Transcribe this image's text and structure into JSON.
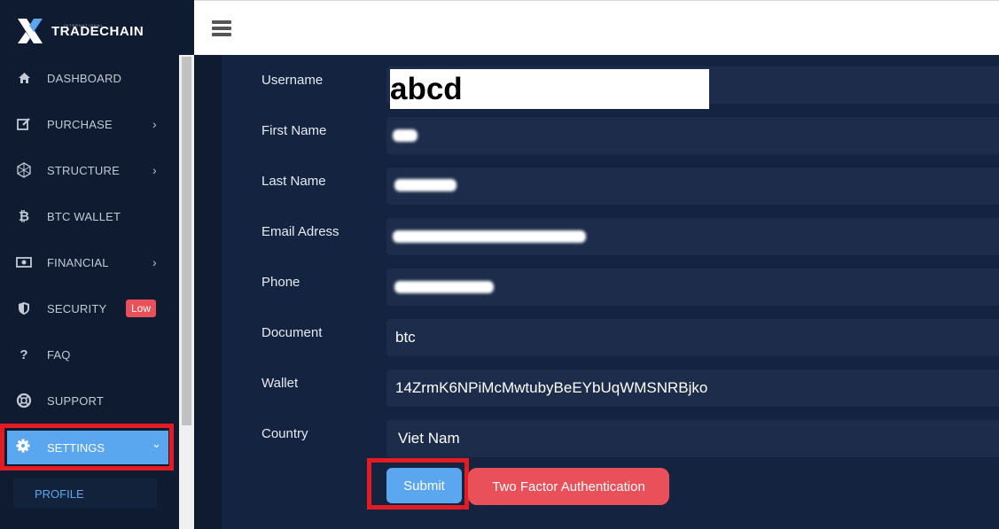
{
  "brand": {
    "name": "TRADECHAIN",
    "tagline": "INTERNATIONAL",
    "accent": "#5aa7ef"
  },
  "sidebar": {
    "items": [
      {
        "label": "DASHBOARD",
        "icon": "home-icon",
        "chevron": ""
      },
      {
        "label": "PURCHASE",
        "icon": "edit-icon",
        "chevron": "›"
      },
      {
        "label": "STRUCTURE",
        "icon": "network-icon",
        "chevron": "›"
      },
      {
        "label": "BTC WALLET",
        "icon": "bitcoin-icon",
        "chevron": ""
      },
      {
        "label": "FINANCIAL",
        "icon": "money-icon",
        "chevron": "›"
      },
      {
        "label": "SECURITY",
        "icon": "shield-icon",
        "chevron": "",
        "badge": "Low"
      },
      {
        "label": "FAQ",
        "icon": "question-icon",
        "chevron": ""
      },
      {
        "label": "SUPPORT",
        "icon": "lifebuoy-icon",
        "chevron": ""
      }
    ],
    "settings": {
      "label": "SETTINGS",
      "icon": "gear-icon",
      "chevron": "⌄"
    },
    "subitems": [
      {
        "label": "PROFILE"
      }
    ]
  },
  "form": {
    "fields": [
      {
        "label": "Username",
        "value": "abcd"
      },
      {
        "label": "First Name",
        "value": ""
      },
      {
        "label": "Last Name",
        "value": ""
      },
      {
        "label": "Email Adress",
        "value": ""
      },
      {
        "label": "Phone",
        "value": ""
      },
      {
        "label": "Document",
        "value": "btc"
      },
      {
        "label": "Wallet",
        "value": "14ZrmK6NPiMcMwtubyBeEYbUqWMSNRBjko"
      },
      {
        "label": "Country",
        "value": "Viet Nam"
      }
    ],
    "submit_label": "Submit",
    "two_factor_label": "Two Factor Authentication"
  }
}
